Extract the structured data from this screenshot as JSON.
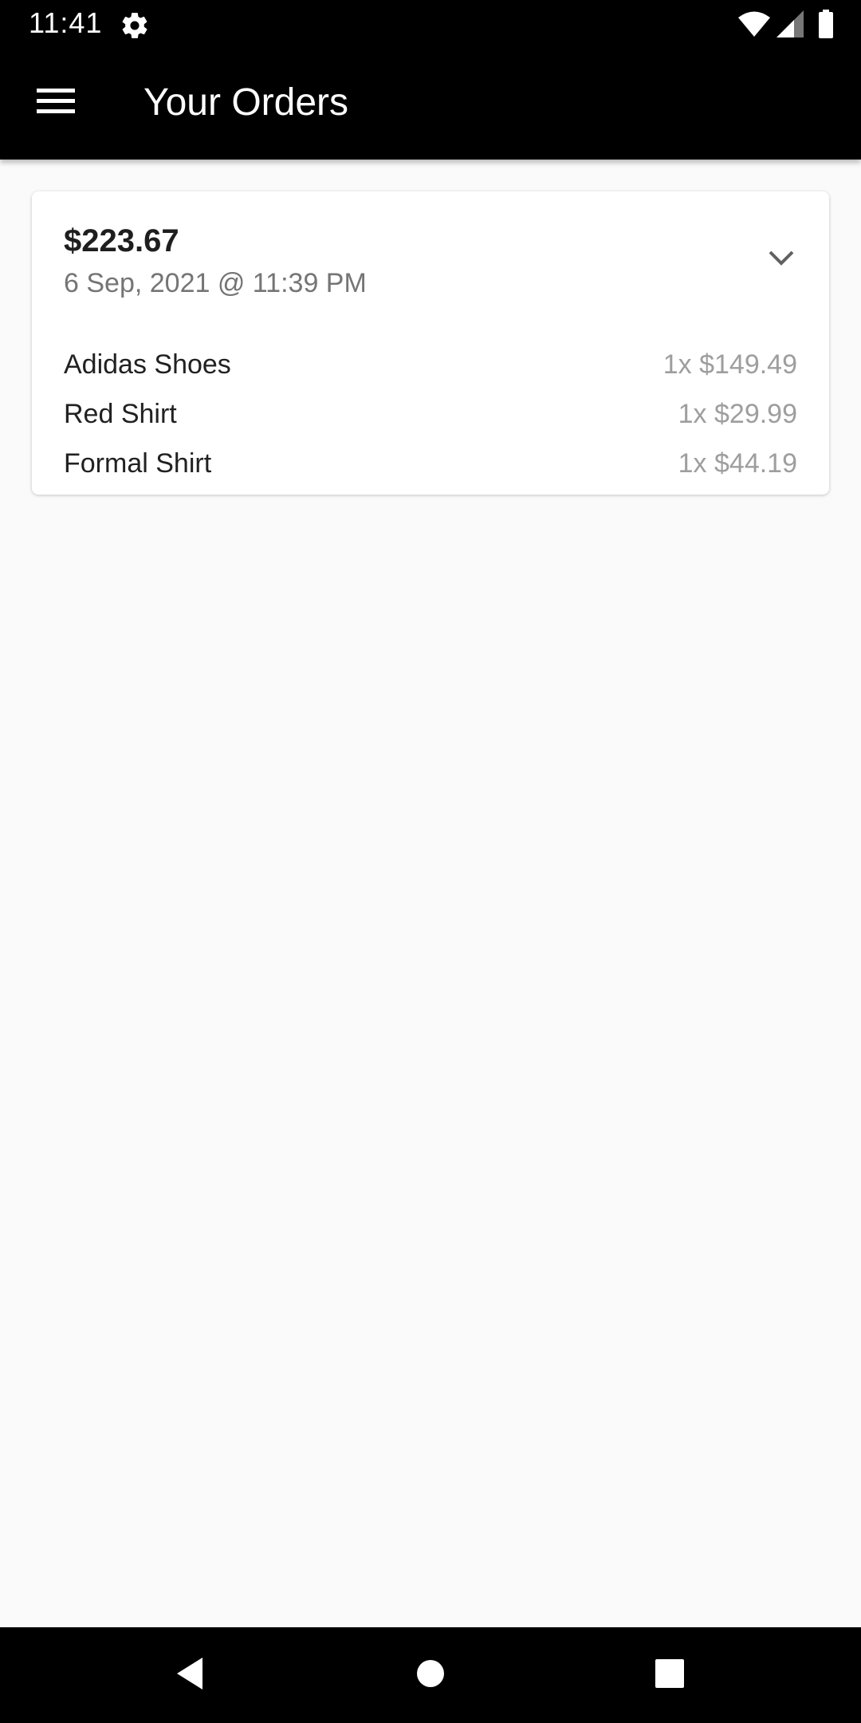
{
  "status_bar": {
    "time": "11:41",
    "icons": [
      "gear-icon",
      "wifi-icon",
      "signal-icon",
      "battery-icon"
    ]
  },
  "app_bar": {
    "menu_icon": "hamburger-menu-icon",
    "title": "Your Orders"
  },
  "orders": [
    {
      "total": "$223.67",
      "date": "6 Sep, 2021 @ 11:39 PM",
      "expand_icon": "chevron-down-icon",
      "items": [
        {
          "name": "Adidas Shoes",
          "price": "1x $149.49"
        },
        {
          "name": "Red Shirt",
          "price": "1x $29.99"
        },
        {
          "name": "Formal Shirt",
          "price": "1x $44.19"
        }
      ]
    }
  ],
  "nav_bar": {
    "icons": [
      "back-icon",
      "home-icon",
      "recents-icon"
    ]
  },
  "colors": {
    "app_bar": "#000000",
    "background": "#fafafa",
    "card": "#ffffff",
    "secondary_text": "#757575",
    "price_text": "#9e9e9e"
  }
}
